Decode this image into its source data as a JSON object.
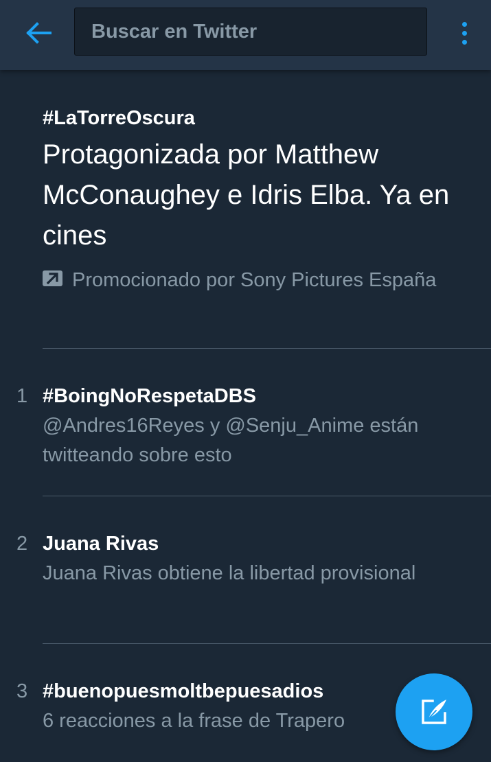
{
  "search": {
    "placeholder": "Buscar en Twitter"
  },
  "promoted": {
    "hashtag": "#LaTorreOscura",
    "description": "Protagonizada por Matthew McConaughey e Idris Elba. Ya en cines",
    "promoted_by": "Promocionado por Sony Pictures España",
    "icon": "promoted-arrow-icon"
  },
  "trends": [
    {
      "rank": "1",
      "title": "#BoingNoRespetaDBS",
      "subtitle": "@Andres16Reyes y @Senju_Anime están twitteando sobre esto"
    },
    {
      "rank": "2",
      "title": "Juana Rivas",
      "subtitle": "Juana Rivas obtiene la libertad provisional"
    },
    {
      "rank": "3",
      "title": "#buenopuesmoltbepuesadios",
      "subtitle": "6 reacciones a la frase de Trapero"
    }
  ],
  "icons": {
    "back": "arrow-left-icon",
    "overflow": "more-vertical-icon",
    "compose": "compose-tweet-icon"
  },
  "colors": {
    "background": "#1b2836",
    "topbar": "#243447",
    "accent": "#1da1f2",
    "secondary_text": "#8899a6"
  }
}
